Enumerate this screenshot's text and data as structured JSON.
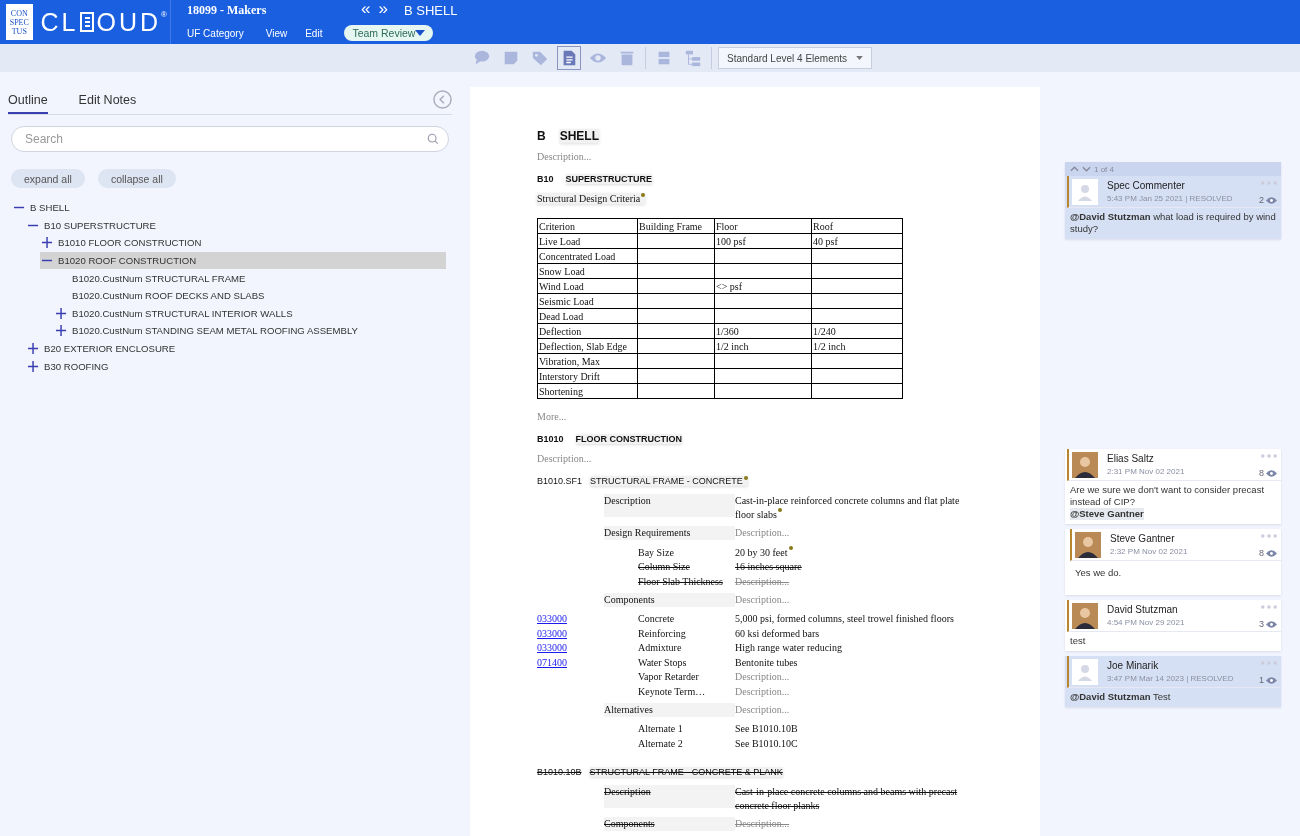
{
  "header": {
    "logo": {
      "stack": [
        "CON",
        "SPEC",
        "TUS"
      ],
      "word": "CL",
      "word_rest": "OUD",
      "mark": "®"
    },
    "project": "18099 - Makers",
    "menus": [
      "UF Category",
      "View",
      "Edit"
    ],
    "mode": "Team Review",
    "nav": [
      "«",
      "»"
    ],
    "title": "B SHELL"
  },
  "toolbar": {
    "groups": [
      {
        "tools": [
          {
            "kind": "comment",
            "selected": false
          },
          {
            "kind": "note",
            "selected": false
          },
          {
            "kind": "tag",
            "selected": false
          },
          {
            "kind": "document",
            "selected": true
          },
          {
            "kind": "eye",
            "selected": false
          },
          {
            "kind": "trash",
            "selected": false
          }
        ]
      },
      {
        "tools": [
          {
            "kind": "split",
            "selected": false
          },
          {
            "kind": "tree",
            "selected": false
          }
        ]
      }
    ],
    "level_select": "Standard Level 4 Elements"
  },
  "sidebar": {
    "tabs": [
      {
        "label": "Outline",
        "selected": true
      },
      {
        "label": "Edit Notes",
        "selected": false
      }
    ],
    "search": {
      "placeholder": "Search"
    },
    "buttons": [
      "expand all",
      "collapse all"
    ],
    "tree": [
      {
        "label": "B SHELL",
        "expanded": true,
        "selected": false,
        "children": [
          {
            "label": "B10 SUPERSTRUCTURE",
            "expanded": true,
            "selected": false,
            "children": [
              {
                "label": "B1010 FLOOR CONSTRUCTION",
                "expanded": false,
                "selected": false
              },
              {
                "label": "B1020 ROOF CONSTRUCTION",
                "expanded": true,
                "selected": true,
                "children": [
                  {
                    "label": "B1020.CustNum STRUCTURAL FRAME",
                    "selected": false
                  },
                  {
                    "label": "B1020.CustNum ROOF DECKS AND SLABS",
                    "selected": false
                  },
                  {
                    "label": "B1020.CustNum STRUCTURAL INTERIOR WALLS",
                    "expanded": false,
                    "selected": false
                  },
                  {
                    "label": "B1020.CustNum STANDING SEAM METAL ROOFING ASSEMBLY",
                    "expanded": false,
                    "selected": false
                  }
                ]
              }
            ]
          },
          {
            "label": "B20 EXTERIOR ENCLOSURE",
            "expanded": false,
            "selected": false
          },
          {
            "label": "B30 ROOFING",
            "expanded": false,
            "selected": false
          }
        ]
      }
    ]
  },
  "document": {
    "blocks": [
      {
        "kind": "h1",
        "code": "B",
        "name": "SHELL"
      },
      {
        "kind": "placeholder",
        "text": "Description..."
      },
      {
        "kind": "h2",
        "code": "B10",
        "name": "SUPERSTRUCTURE"
      },
      {
        "kind": "note",
        "text": "Structural Design Criteria",
        "flagged": true
      },
      {
        "kind": "table",
        "columns": [
          "Criterion",
          "Building Frame",
          "Floor",
          "Roof"
        ],
        "rows": [
          [
            "Live Load",
            "",
            "100 psf",
            "40 psf"
          ],
          [
            "Concentrated Load",
            "",
            "",
            ""
          ],
          [
            "Snow Load",
            "",
            "",
            ""
          ],
          [
            "Wind Load",
            "",
            "<> psf",
            ""
          ],
          [
            "Seismic Load",
            "",
            "",
            ""
          ],
          [
            "Dead Load",
            "",
            "",
            ""
          ],
          [
            "Deflection",
            "",
            "1/360",
            "1/240"
          ],
          [
            "Deflection, Slab Edge",
            "",
            "1/2 inch",
            "1/2 inch"
          ],
          [
            "Vibration, Max",
            "",
            "",
            ""
          ],
          [
            "Interstory Drift",
            "",
            "",
            ""
          ],
          [
            "Shortening",
            "",
            "",
            ""
          ]
        ]
      },
      {
        "kind": "placeholder",
        "text": "More..."
      },
      {
        "kind": "h2",
        "code": "B1010",
        "name": "FLOOR CONSTRUCTION"
      },
      {
        "kind": "placeholder",
        "text": "Description..."
      },
      {
        "kind": "h3",
        "code": "B1010.SF1",
        "name": "STRUCTURAL FRAME - CONCRETE",
        "flagged": true,
        "deleted": false
      },
      {
        "kind": "grid",
        "rows": [
          {
            "kind": "group",
            "label": "Description",
            "value": "Cast-in-place reinforced concrete columns and flat plate floor slabs",
            "empty": false,
            "flagged": true,
            "deleted": false
          },
          {
            "kind": "group",
            "label": "Design Requirements",
            "value": "Description...",
            "empty": true,
            "flagged": false,
            "deleted": false
          },
          {
            "kind": "item",
            "label": "Bay Size",
            "value": "20 by 30 feet",
            "empty": false,
            "flagged": true,
            "deleted": false
          },
          {
            "kind": "item",
            "label": "Column Size",
            "value": "16 inches square",
            "empty": false,
            "flagged": false,
            "deleted": true
          },
          {
            "kind": "item",
            "label": "Floor Slab Thickness",
            "value": "Description...",
            "empty": true,
            "flagged": false,
            "deleted": true
          },
          {
            "kind": "group",
            "label": "Components",
            "value": "Description...",
            "empty": true,
            "flagged": false,
            "deleted": false
          },
          {
            "kind": "item",
            "link": "033000",
            "label": "Concrete",
            "value": "5,000 psi, formed columns, steel trowel finished floors",
            "empty": false,
            "flagged": false,
            "deleted": false
          },
          {
            "kind": "item",
            "link": "033000",
            "label": "Reinforcing",
            "value": "60 ksi deformed bars",
            "empty": false,
            "flagged": false,
            "deleted": false
          },
          {
            "kind": "item",
            "link": "033000",
            "label": "Admixture",
            "value": "High range water reducing",
            "empty": false,
            "flagged": false,
            "deleted": false
          },
          {
            "kind": "item",
            "link": "071400",
            "label": "Water Stops",
            "value": "Bentonite tubes",
            "empty": false,
            "flagged": false,
            "deleted": false
          },
          {
            "kind": "item",
            "label": "Vapor Retarder",
            "value": "Description...",
            "empty": true,
            "flagged": false,
            "deleted": false
          },
          {
            "kind": "item",
            "label": "Keynote Term…",
            "value": "Description...",
            "empty": true,
            "flagged": false,
            "deleted": false
          },
          {
            "kind": "group",
            "label": "Alternatives",
            "value": "Description...",
            "empty": true,
            "flagged": false,
            "deleted": false
          },
          {
            "kind": "item",
            "label": "Alternate 1",
            "value": "See B1010.10B",
            "empty": false,
            "flagged": false,
            "deleted": false
          },
          {
            "kind": "item",
            "label": "Alternate 2",
            "value": "See B1010.10C",
            "empty": false,
            "flagged": false,
            "deleted": false
          }
        ]
      },
      {
        "kind": "h3",
        "code": "B1010.10B",
        "name": "STRUCTURAL FRAME - CONCRETE & PLANK",
        "flagged": false,
        "deleted": true
      },
      {
        "kind": "grid",
        "rows": [
          {
            "kind": "group",
            "label": "Description",
            "value": "Cast-in-place concrete columns and beams with precast concrete floor planks",
            "empty": false,
            "flagged": false,
            "deleted": true
          },
          {
            "kind": "group",
            "label": "Components",
            "value": "Description...",
            "empty": true,
            "flagged": false,
            "deleted": true
          }
        ]
      }
    ]
  },
  "comments": [
    {
      "nav": "1 of 4",
      "items": [
        {
          "author": "Spec Commenter",
          "kind": "placeholder",
          "time": "5:43 PM Jan 25 2021 | RESOLVED",
          "resolved": true,
          "reply": false,
          "views": "2",
          "text": "**@David Stutzman** what load is required by wind study?"
        }
      ]
    },
    {
      "items": [
        {
          "author": "Elias Saltz",
          "kind": "photo",
          "time": "2:31 PM Nov 02 2021",
          "resolved": false,
          "reply": false,
          "views": "8",
          "text": "Are we sure we don't want to consider precast instead of CIP?",
          "mention": "@Steve Gantner"
        },
        {
          "author": "Steve Gantner",
          "kind": "photo",
          "time": "2:32 PM Nov 02 2021",
          "resolved": false,
          "reply": true,
          "views": "8",
          "text": "Yes we do."
        },
        {
          "author": "David Stutzman",
          "kind": "photo",
          "time": "4:54 PM Nov 29 2021",
          "resolved": false,
          "reply": false,
          "views": "3",
          "text": "test"
        },
        {
          "author": "Joe Minarik",
          "kind": "placeholder",
          "time": "3:47 PM Mar 14 2023 | RESOLVED",
          "resolved": true,
          "reply": false,
          "views": "1",
          "text": "**@David Stutzman** Test"
        }
      ]
    }
  ]
}
